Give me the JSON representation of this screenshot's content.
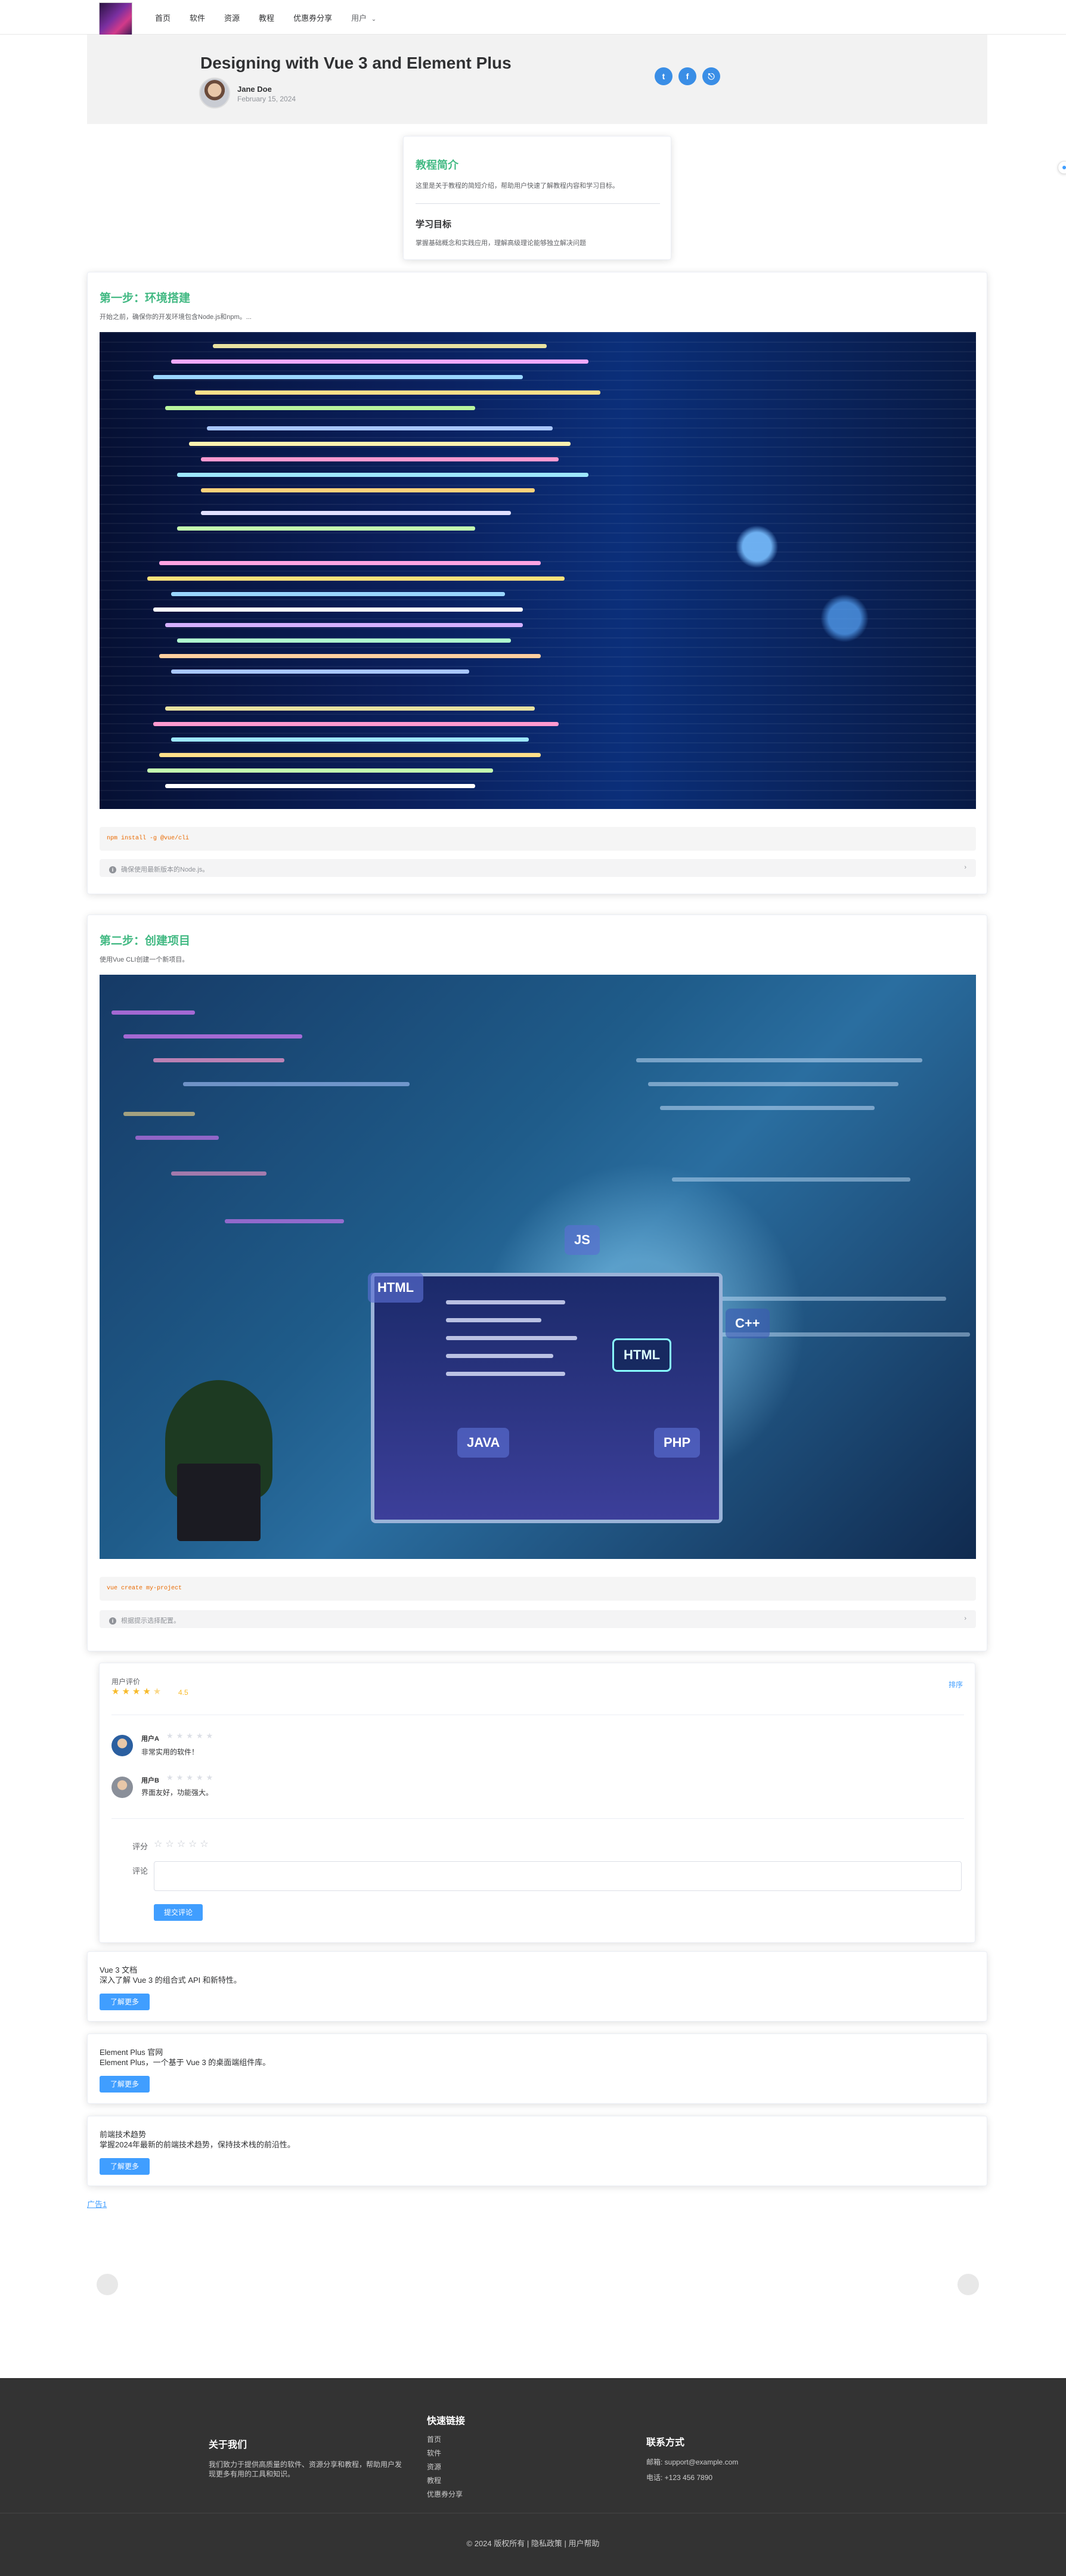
{
  "nav": {
    "items": [
      "首页",
      "软件",
      "资源",
      "教程",
      "优惠券分享"
    ],
    "user_menu": "用户"
  },
  "article": {
    "title": "Designing with Vue 3 and Element Plus",
    "author": "Jane Doe",
    "date": "February 15, 2024",
    "social": [
      "twitter-icon",
      "facebook-icon",
      "link-icon"
    ]
  },
  "intro": {
    "title": "教程简介",
    "text": "这里是关于教程的简短介绍，帮助用户快速了解教程内容和学习目标。",
    "goal_title": "学习目标",
    "goal_text": "掌握基础概念和实践应用，理解高级理论能够独立解决问题"
  },
  "steps": [
    {
      "title": "第一步：环境搭建",
      "desc": "开始之前，确保你的开发环境包含Node.js和npm。...",
      "code": "npm install -g @vue/cli",
      "note": "确保使用最新版本的Node.js。"
    },
    {
      "title": "第二步：创建项目",
      "desc": "使用Vue CLI创建一个新项目。",
      "code": "vue create my-project",
      "note": "根据提示选择配置。",
      "image_tags": [
        "HTML",
        "JS",
        "JAVA",
        "PHP",
        "C++",
        "HTML"
      ]
    }
  ],
  "reviews": {
    "label": "用户评价",
    "rating": 4.5,
    "score_text": "4.5",
    "sort_label": "排序",
    "items": [
      {
        "name": "用户A",
        "text": "非常实用的软件！"
      },
      {
        "name": "用户B",
        "text": "界面友好，功能强大。"
      }
    ],
    "form": {
      "rating_label": "评分",
      "comment_label": "评论",
      "submit": "提交评论"
    }
  },
  "links": [
    {
      "title": "Vue 3 文档",
      "desc": "深入了解 Vue 3 的组合式 API 和新特性。",
      "button": "了解更多"
    },
    {
      "title": "Element Plus 官网",
      "desc": "Element Plus，一个基于 Vue 3 的桌面端组件库。",
      "button": "了解更多"
    },
    {
      "title": "前端技术趋势",
      "desc": "掌握2024年最新的前端技术趋势，保持技术栈的前沿性。",
      "button": "了解更多"
    }
  ],
  "ad_link": "广告1",
  "footer": {
    "about_title": "关于我们",
    "about_text": [
      "我们致力于提供高质量的软件、资源分享和教程，帮助用户发",
      "现更多有用的工具和知识。"
    ],
    "links_title": "快速链接",
    "links": [
      "首页",
      "软件",
      "资源",
      "教程",
      "优惠券分享"
    ],
    "contact_title": "联系方式",
    "email": "邮箱: support@example.com",
    "phone": "电话: +123 456 7890",
    "copyright": "© 2024 版权所有 | 隐私政策 | 用户帮助"
  }
}
